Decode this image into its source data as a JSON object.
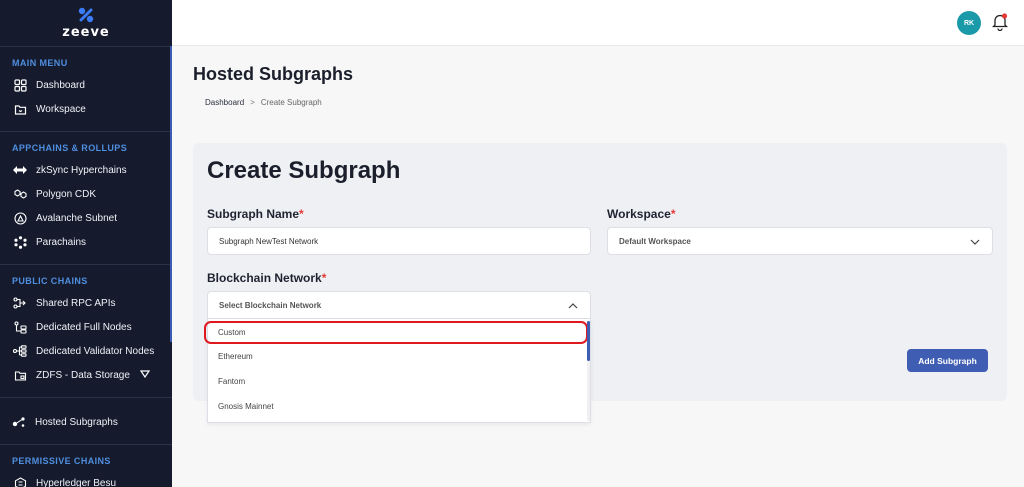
{
  "sidebar": {
    "logo_text": "zeeve",
    "sections": [
      {
        "title": "MAIN MENU",
        "items": [
          "Dashboard",
          "Workspace"
        ]
      },
      {
        "title": "APPCHAINS & ROLLUPS",
        "items": [
          "zkSync Hyperchains",
          "Polygon CDK",
          "Avalanche Subnet",
          "Parachains"
        ]
      },
      {
        "title": "PUBLIC CHAINS",
        "items": [
          "Shared RPC APIs",
          "Dedicated Full Nodes",
          "Dedicated Validator Nodes",
          "ZDFS - Data Storage"
        ]
      },
      {
        "title": "",
        "items": [
          "Hosted Subgraphs"
        ]
      },
      {
        "title": "PERMISSIVE CHAINS",
        "items": [
          "Hyperledger Besu"
        ]
      }
    ]
  },
  "topbar": {
    "avatar_initials": "RK"
  },
  "page": {
    "title": "Hosted Subgraphs",
    "breadcrumb": {
      "home": "Dashboard",
      "separator": ">",
      "current": "Create Subgraph"
    }
  },
  "form": {
    "title": "Create Subgraph",
    "subgraph_name_label": "Subgraph Name",
    "subgraph_name_value": "Subgraph NewTest Network",
    "workspace_label": "Workspace",
    "workspace_value": "Default Workspace",
    "network_label": "Blockchain Network",
    "network_placeholder": "Select Blockchain Network",
    "required_mark": "*",
    "submit_label": "Add Subgraph",
    "network_options": [
      "Custom",
      "Ethereum",
      "Fantom",
      "Gnosis Mainnet"
    ]
  },
  "colors": {
    "sidebar_bg": "#151a2c",
    "section_title": "#4f8fe0",
    "primary": "#3f5db2",
    "highlight": "#e0191f"
  }
}
